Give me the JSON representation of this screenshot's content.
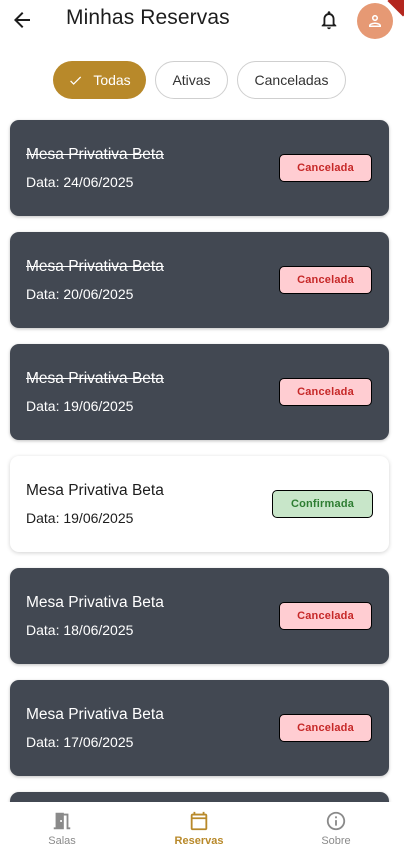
{
  "header": {
    "title": "Minhas Reservas"
  },
  "filters": [
    {
      "label": "Todas",
      "selected": true
    },
    {
      "label": "Ativas",
      "selected": false
    },
    {
      "label": "Canceladas",
      "selected": false
    }
  ],
  "reservations": [
    {
      "title": "Mesa Privativa Beta",
      "date": "Data: 24/06/2025",
      "status": "Cancelada",
      "struck": true
    },
    {
      "title": "Mesa Privativa Beta",
      "date": "Data: 20/06/2025",
      "status": "Cancelada",
      "struck": true
    },
    {
      "title": "Mesa Privativa Beta",
      "date": "Data: 19/06/2025",
      "status": "Cancelada",
      "struck": true
    },
    {
      "title": "Mesa Privativa Beta",
      "date": "Data: 19/06/2025",
      "status": "Confirmada",
      "struck": false
    },
    {
      "title": "Mesa Privativa Beta",
      "date": "Data: 18/06/2025",
      "status": "Cancelada",
      "struck": false
    },
    {
      "title": "Mesa Privativa Beta",
      "date": "Data: 17/06/2025",
      "status": "Cancelada",
      "struck": false
    }
  ],
  "bottom_nav": [
    {
      "label": "Salas",
      "icon": "door-icon",
      "active": false
    },
    {
      "label": "Reservas",
      "icon": "calendar-icon",
      "active": true
    },
    {
      "label": "Sobre",
      "icon": "info-icon",
      "active": false
    }
  ],
  "colors": {
    "accent": "#b8892a",
    "card_dark": "#424852",
    "avatar": "#e69974",
    "cancel_bg": "#ffcdd2",
    "cancel_text": "#c62828",
    "confirm_bg": "#c8e6c9",
    "confirm_text": "#2e7d32"
  }
}
